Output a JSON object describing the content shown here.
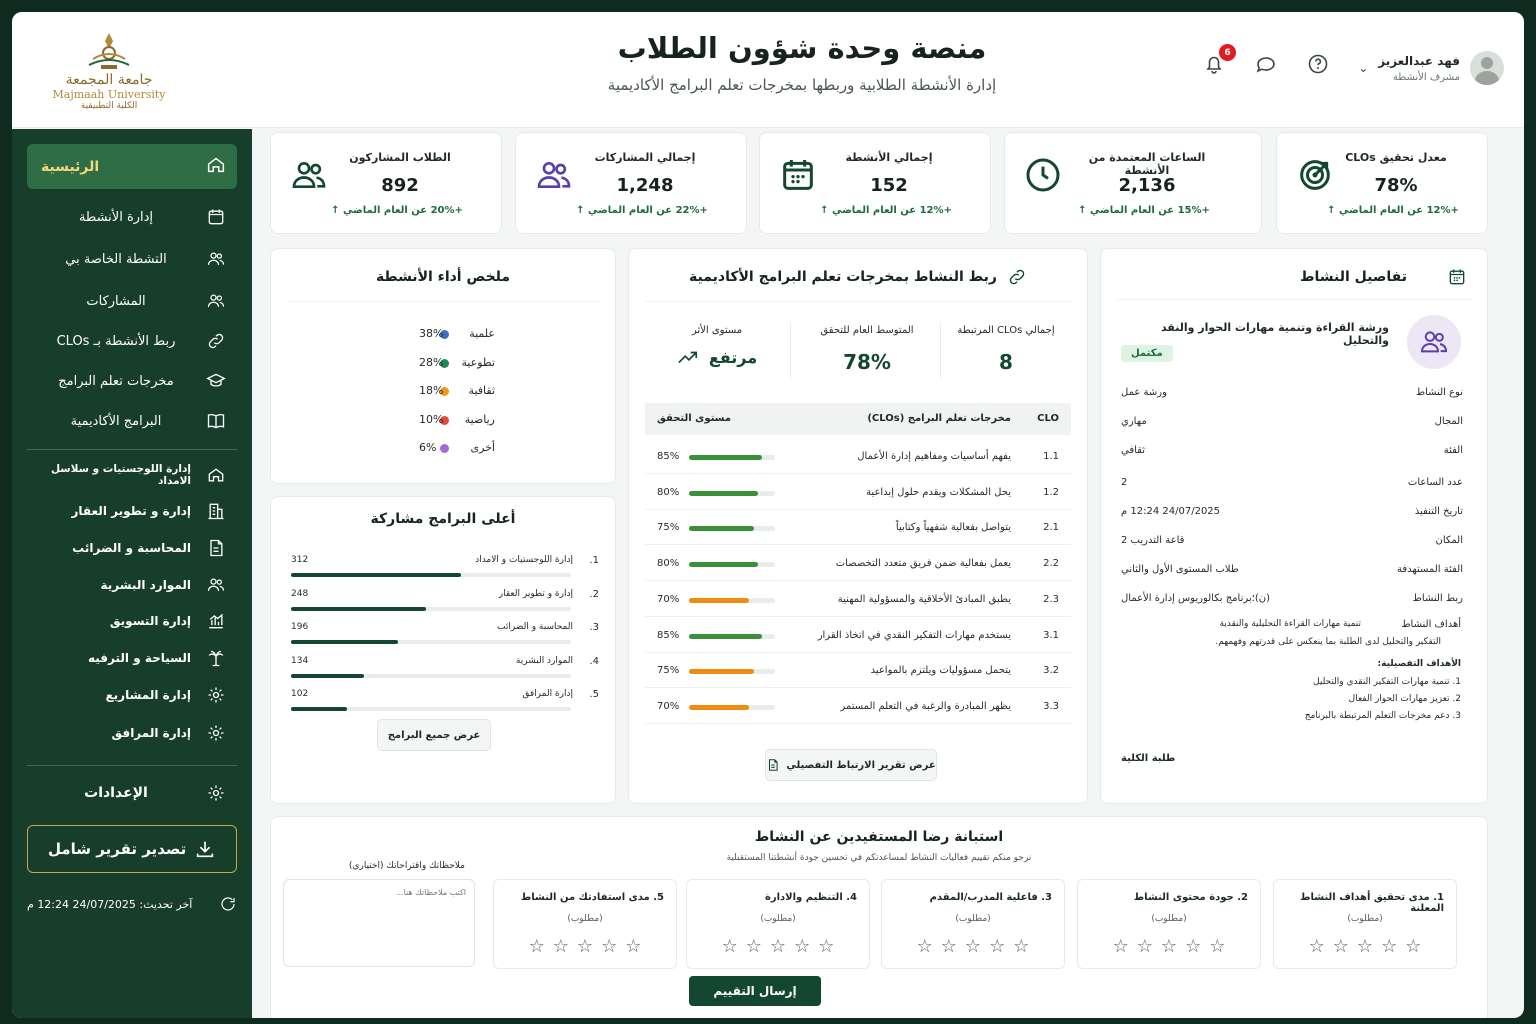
{
  "brand": {
    "logo_ar": "جامعة المجمعة",
    "logo_en": "Majmaah University",
    "logo_sub": "الكلية التطبيقية"
  },
  "header": {
    "title": "منصة وحدة شؤون الطلاب",
    "subtitle": "إدارة الأنشطة الطلابية وربطها بمخرجات تعلم البرامج الأكاديمية",
    "notif_count": "6"
  },
  "user": {
    "name": "فهد عبدالعزيز",
    "role": "مشرف الأنشطة"
  },
  "sidebar": {
    "main": {
      "label": "الرئيسية",
      "icon": "home-icon"
    },
    "items": [
      {
        "label": "إدارة الأنشطة",
        "icon": "calendar-icon"
      },
      {
        "label": "التشطة الخاصة بي",
        "icon": "users-icon"
      },
      {
        "label": "المشاركات",
        "icon": "users-icon"
      },
      {
        "label": "ربط الأنشطة بـ CLOs",
        "icon": "link-icon"
      },
      {
        "label": "مخرجات تعلم البرامج",
        "icon": "graduation-cap-icon"
      },
      {
        "label": "البرامج الأكاديمية",
        "icon": "book-icon"
      }
    ],
    "programs": [
      {
        "label": "إدارة اللوجستيات و سلاسل الامداد",
        "icon": "home-icon"
      },
      {
        "label": "إدارة و تطوير العقار",
        "icon": "building-icon"
      },
      {
        "label": "المحاسبة و الضرائب",
        "icon": "document-icon"
      },
      {
        "label": "الموارد البشرية",
        "icon": "users-icon"
      },
      {
        "label": "إدارة التسويق",
        "icon": "chart-icon"
      },
      {
        "label": "السياحة و الترفيه",
        "icon": "palm-icon"
      },
      {
        "label": "إدارة المشاريع",
        "icon": "gear-icon"
      },
      {
        "label": "إدارة المرافق",
        "icon": "gear-icon"
      }
    ],
    "settings": {
      "label": "الإعدادات",
      "icon": "gear-icon"
    },
    "export_label": "تصدير تقرير شامل",
    "last_update": "آخر تحديث: 24/07/2025 12:24 م"
  },
  "kpis": [
    {
      "title": "معدل تحقيق CLOs",
      "value": "78%",
      "delta": "+12% عن العام الماضي",
      "icon": "target-icon"
    },
    {
      "title": "الساعات المعتمدة من الأنشطة",
      "value": "2,136",
      "delta": "+15% عن العام الماضي",
      "icon": "clock-icon"
    },
    {
      "title": "إجمالي الأنشطة",
      "value": "152",
      "delta": "+12% عن العام الماضي",
      "icon": "calendar-icon"
    },
    {
      "title": "إجمالي المشاركات",
      "value": "1,248",
      "delta": "+22% عن العام الماضي",
      "icon": "users-icon"
    },
    {
      "title": "الطلاب المشاركون",
      "value": "892",
      "delta": "+20% عن العام الماضي",
      "icon": "users-icon"
    }
  ],
  "details": {
    "title": "تفاصيل النشاط",
    "activity_name": "ورشة القراءة وتنمية مهارات الحوار والنقد والتحليل",
    "status": "مكتمل",
    "rows": [
      {
        "k": "نوع النشاط",
        "v": "ورشة عمل"
      },
      {
        "k": "المجال",
        "v": "مهاري"
      },
      {
        "k": "الفئة",
        "v": "ثقافي"
      },
      {
        "k": "عدد الساعات",
        "v": "2"
      },
      {
        "k": "تاريخ التنفيذ",
        "v": "24/07/2025    12:24 م"
      },
      {
        "k": "المكان",
        "v": "قاعة التدريب 2"
      },
      {
        "k": "الفئة المستهدفة",
        "v": "طلاب المستوى الأول والثاني"
      },
      {
        "k": "ربط النشاط",
        "v": "(ن)؛برنامج بكالوريوس إدارة الأعمال"
      }
    ],
    "goals_label": "أهداف النشاط",
    "goals_text1": "تنمية مهارات القراءة التحليلية والنقدية",
    "goals_text2": "التفكير والتحليل لدى الطلبة بما ينعكس على قدرتهم وفهمهم.",
    "detailed_label": "الأهداف التفصيلية:",
    "detailed": [
      "1.  تنمية مهارات التفكير النقدي والتحليل",
      "2.  تعزيز مهارات الحوار الفعال",
      "3.  دعم مخرجات التعلم المرتبطة بالبرنامج"
    ],
    "audience_note": "طلبة الكلية"
  },
  "linking": {
    "title": "ربط النشاط بمخرجات تعلم البرامج الأكاديمية",
    "stats": [
      {
        "label": "إجمالي CLOs المرتبطة",
        "value": "8"
      },
      {
        "label": "المتوسط العام للتحقق",
        "value": "78%"
      },
      {
        "label": "مستوى الأثر",
        "value": "مرتفع"
      }
    ],
    "headers": {
      "clo": "CLO",
      "outcome": "مخرجات تعلم البرامج (CLOs)",
      "level": "مستوى التحقق"
    },
    "rows": [
      {
        "id": "1.1",
        "text": "يفهم أساسيات ومفاهيم إدارة الأعمال",
        "pct": "85%",
        "value": 85,
        "color": "#3a8f3a"
      },
      {
        "id": "1.2",
        "text": "يحل المشكلات ويقدم حلول إبداعية",
        "pct": "80%",
        "value": 80,
        "color": "#3a8f3a"
      },
      {
        "id": "2.1",
        "text": "يتواصل بفعالية شفهياً وكتابياً",
        "pct": "75%",
        "value": 75,
        "color": "#3a8f3a"
      },
      {
        "id": "2.2",
        "text": "يعمل بفعالية ضمن فريق متعدد التخصصات",
        "pct": "80%",
        "value": 80,
        "color": "#3a8f3a"
      },
      {
        "id": "2.3",
        "text": "يطبق المبادئ الأخلاقية والمسؤولية المهنية",
        "pct": "70%",
        "value": 70,
        "color": "#ef8c12"
      },
      {
        "id": "3.1",
        "text": "يستخدم مهارات التفكير النقدي في اتخاذ القرار",
        "pct": "85%",
        "value": 85,
        "color": "#3a8f3a"
      },
      {
        "id": "3.2",
        "text": "يتحمل مسؤوليات ويلتزم بالمواعيد",
        "pct": "75%",
        "value": 75,
        "color": "#ef8c12"
      },
      {
        "id": "3.3",
        "text": "يظهر المبادرة والرغبة في التعلم المستمر",
        "pct": "70%",
        "value": 70,
        "color": "#ef8c12"
      }
    ],
    "report_btn": "عرض تقرير الارتباط التفصيلي"
  },
  "summary": {
    "title": "ملخص أداء الأنشطة",
    "legend": [
      {
        "name": "علمية",
        "pct": "38%",
        "color": "#3b6fc4"
      },
      {
        "name": "تطوعية",
        "pct": "28%",
        "color": "#1f8a4e"
      },
      {
        "name": "ثقافية",
        "pct": "18%",
        "color": "#f09a1a"
      },
      {
        "name": "رياضية",
        "pct": "10%",
        "color": "#e04b3c"
      },
      {
        "name": "أخرى",
        "pct": "6%",
        "color": "#a46ad6"
      }
    ]
  },
  "top_programs": {
    "title": "أعلى البرامج مشاركة",
    "rows": [
      {
        "rank": "1.",
        "name": "إدارة اللوجستيات و الامداد",
        "count": "312",
        "value": 312
      },
      {
        "rank": "2.",
        "name": "إدارة و تطوير العقار",
        "count": "248",
        "value": 248
      },
      {
        "rank": "3.",
        "name": "المحاسبة و الضرائب",
        "count": "196",
        "value": 196
      },
      {
        "rank": "4.",
        "name": "الموارد البشرية",
        "count": "134",
        "value": 134
      },
      {
        "rank": "5.",
        "name": "إدارة المرافق",
        "count": "102",
        "value": 102
      }
    ],
    "max": 312,
    "all_btn": "عرض جميع البرامج"
  },
  "survey": {
    "title": "استبانة رضا المستفيدين عن النشاط",
    "subtitle": "نرجو منكم تقييم فعاليات النشاط لمساعدتكم في تحسين جودة أنشطتنا المستقبلية",
    "questions": [
      {
        "label": "1.   مدى تحقيق أهداف النشاط المعلنة",
        "req": "(مطلوب)"
      },
      {
        "label": "2.   جودة محتوى النشاط",
        "req": "(مطلوب)"
      },
      {
        "label": "3.   فاعلية المدرب/المقدم",
        "req": "(مطلوب)"
      },
      {
        "label": "4.   التنظيم والادارة",
        "req": "(مطلوب)"
      },
      {
        "label": "5.   مدى استفادتك من النشاط",
        "req": "(مطلوب)"
      }
    ],
    "notes_label": "ملاحظاتك واقتراحاتك (اختياري)",
    "notes_placeholder": "اكتب ملاحظاتك هنا...",
    "submit": "إرسال التقييم"
  }
}
